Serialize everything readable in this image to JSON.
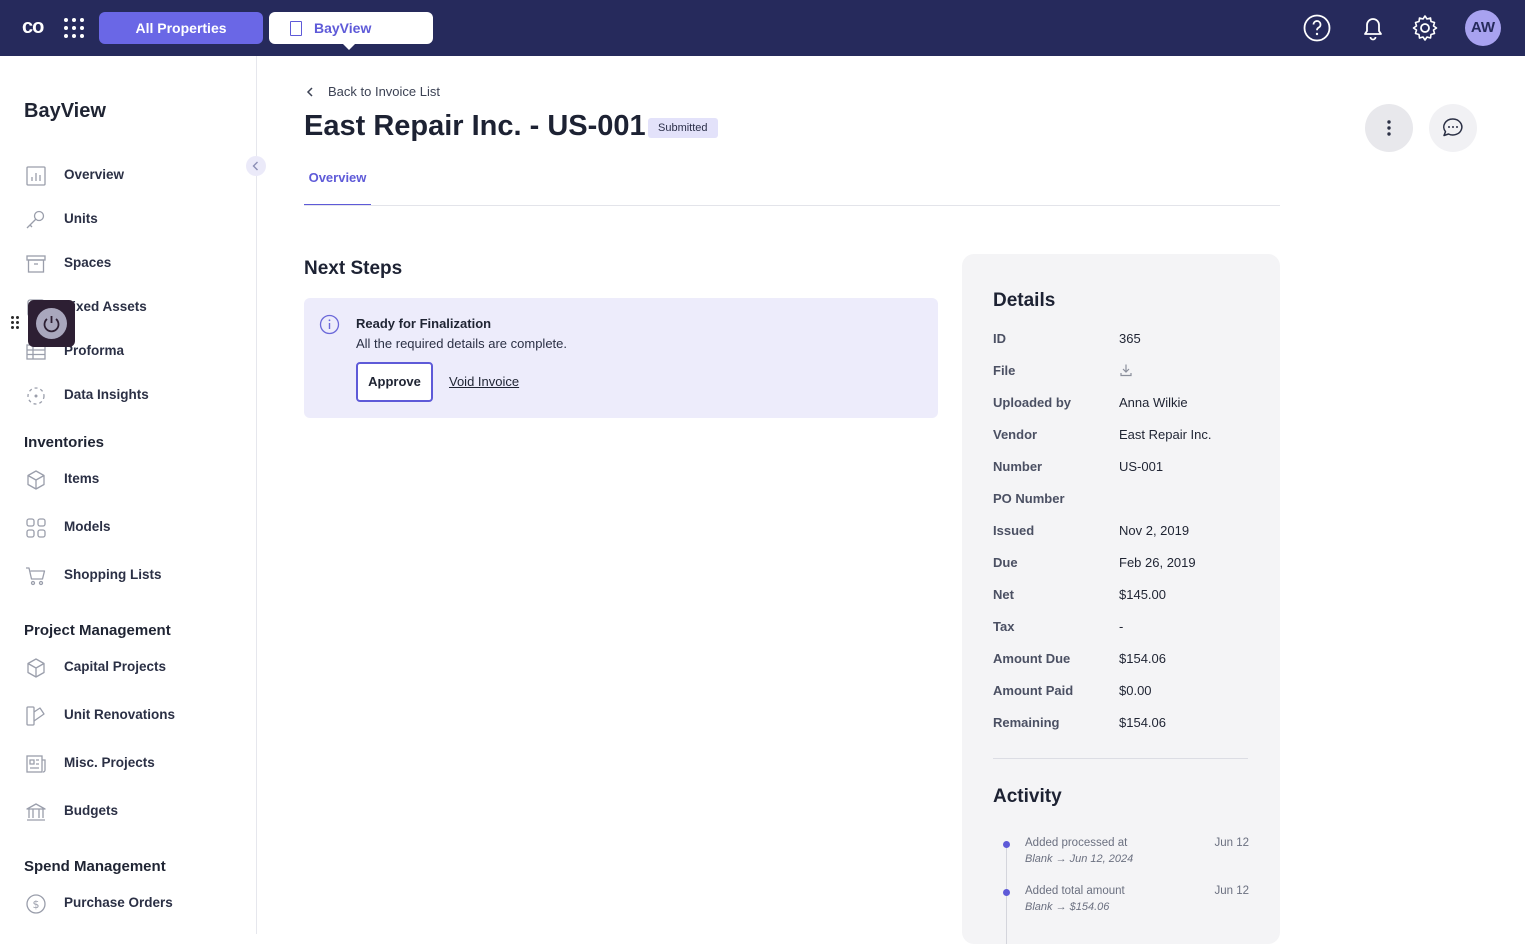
{
  "topbar": {
    "logo": "co",
    "all_properties": "All Properties",
    "property": "BayView",
    "avatar": "AW"
  },
  "sidebar": {
    "title": "BayView",
    "items": [
      {
        "label": "Overview"
      },
      {
        "label": "Units"
      },
      {
        "label": "Spaces"
      },
      {
        "label": "Fixed Assets"
      },
      {
        "label": "Proforma"
      },
      {
        "label": "Data Insights"
      }
    ],
    "sections": [
      {
        "title": "Inventories",
        "items": [
          {
            "label": "Items"
          },
          {
            "label": "Models"
          },
          {
            "label": "Shopping Lists"
          }
        ]
      },
      {
        "title": "Project Management",
        "items": [
          {
            "label": "Capital Projects"
          },
          {
            "label": "Unit Renovations"
          },
          {
            "label": "Misc. Projects"
          },
          {
            "label": "Budgets"
          }
        ]
      },
      {
        "title": "Spend Management",
        "items": [
          {
            "label": "Purchase Orders"
          }
        ]
      }
    ]
  },
  "header": {
    "back_label": "Back to Invoice List",
    "title": "East Repair Inc. - US-001",
    "status": "Submitted",
    "tabs": [
      {
        "label": "Overview"
      }
    ]
  },
  "next_steps": {
    "title": "Next Steps",
    "alert_title": "Ready for Finalization",
    "alert_text": "All the required details are complete.",
    "approve_label": "Approve",
    "void_label": "Void Invoice"
  },
  "details": {
    "title": "Details",
    "rows": [
      {
        "key": "ID",
        "value": "365"
      },
      {
        "key": "File",
        "value": ""
      },
      {
        "key": "Uploaded by",
        "value": "Anna Wilkie"
      },
      {
        "key": "Vendor",
        "value": "East Repair Inc."
      },
      {
        "key": "Number",
        "value": "US-001"
      },
      {
        "key": "PO Number",
        "value": ""
      },
      {
        "key": "Issued",
        "value": "Nov 2, 2019"
      },
      {
        "key": "Due",
        "value": "Feb 26, 2019"
      },
      {
        "key": "Net",
        "value": "$145.00"
      },
      {
        "key": "Tax",
        "value": "-"
      },
      {
        "key": "Amount Due",
        "value": "$154.06"
      },
      {
        "key": "Amount Paid",
        "value": "$0.00"
      },
      {
        "key": "Remaining",
        "value": "$154.06"
      }
    ]
  },
  "activity": {
    "title": "Activity",
    "items": [
      {
        "text": "Added processed at",
        "change": "Blank → Jun 12, 2024",
        "date": "Jun 12"
      },
      {
        "text": "Added total amount",
        "change": "Blank → $154.06",
        "date": "Jun 12"
      }
    ]
  },
  "colors": {
    "topbar": "#262a5c",
    "accent": "#5e5ad8",
    "alert_bg": "#edecfb"
  }
}
